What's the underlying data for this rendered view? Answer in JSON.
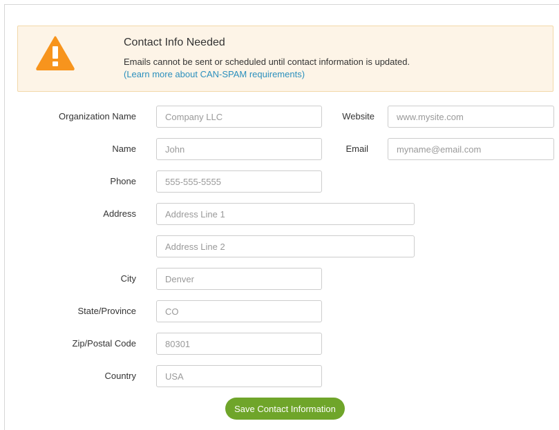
{
  "alert": {
    "title": "Contact Info Needed",
    "message": "Emails cannot be sent or scheduled until contact information is updated.",
    "link": "(Learn more about CAN-SPAM requirements)",
    "icon": "warning-triangle-icon",
    "colors": {
      "background": "#fdf4e7",
      "border": "#f2d8a8",
      "icon": "#f7941d",
      "link": "#2a8fbd"
    }
  },
  "form": {
    "organization": {
      "label": "Organization Name",
      "placeholder": "Company LLC"
    },
    "website": {
      "label": "Website",
      "placeholder": "www.mysite.com"
    },
    "name": {
      "label": "Name",
      "placeholder": "John"
    },
    "email": {
      "label": "Email",
      "placeholder": "myname@email.com"
    },
    "phone": {
      "label": "Phone",
      "placeholder": "555-555-5555"
    },
    "address": {
      "label": "Address",
      "line1_placeholder": "Address Line 1",
      "line2_placeholder": "Address Line 2"
    },
    "city": {
      "label": "City",
      "placeholder": "Denver"
    },
    "state": {
      "label": "State/Province",
      "placeholder": "CO"
    },
    "zip": {
      "label": "Zip/Postal Code",
      "placeholder": "80301"
    },
    "country": {
      "label": "Country",
      "placeholder": "USA"
    }
  },
  "save_button": {
    "label": "Save Contact Information",
    "color": "#6fa52a"
  }
}
